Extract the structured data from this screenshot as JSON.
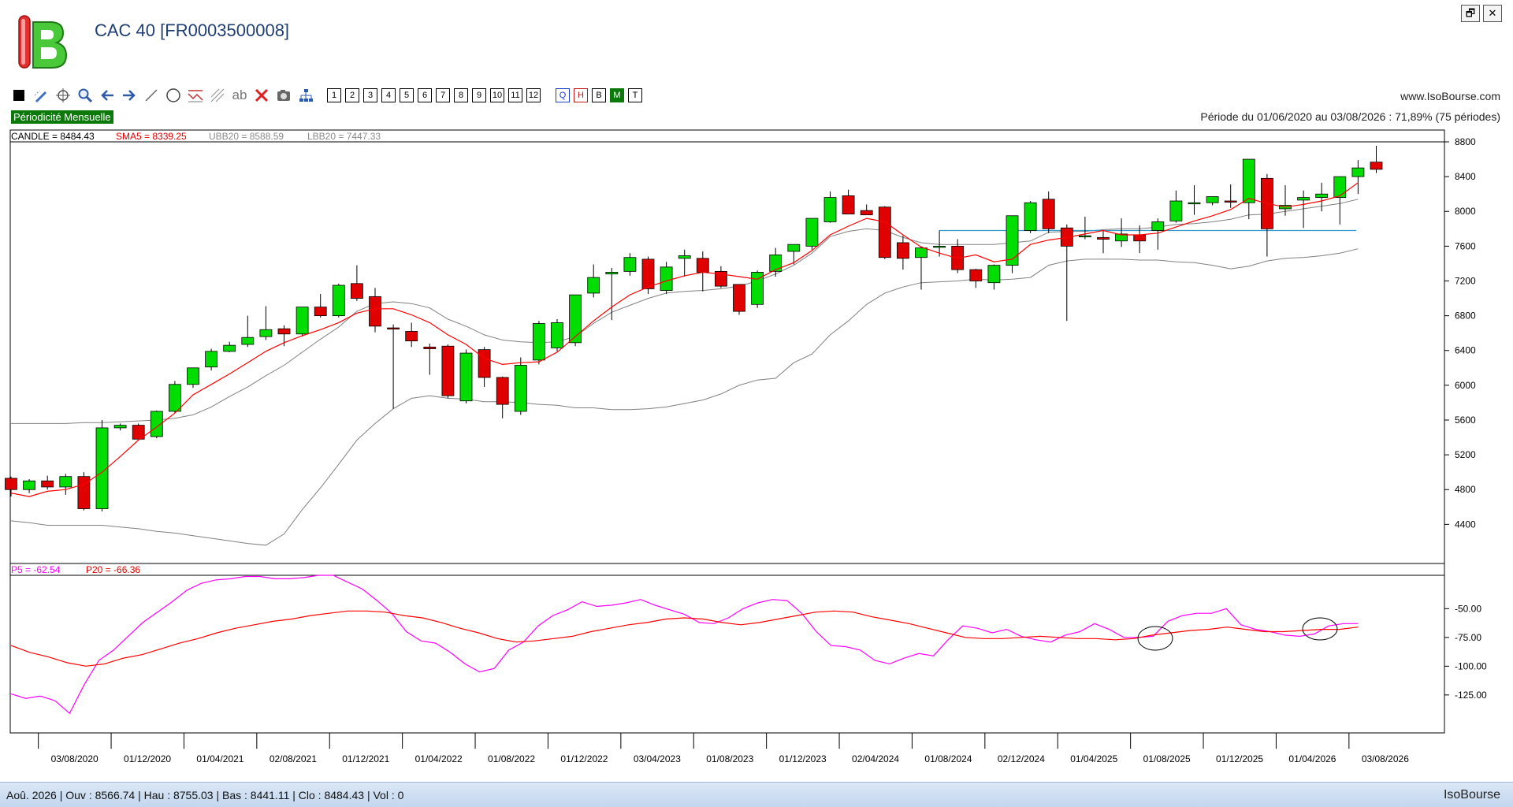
{
  "app": {
    "title": "CAC 40 [FR0003500008]",
    "website": "www.IsoBourse.com",
    "periodicity": "Périodicité Mensuelle",
    "period": "Période du 01/06/2020 au 03/08/2026 : 71,89% (75 périodes)",
    "brand": "IsoBourse",
    "status": "Aoû. 2026 | Ouv : 8566.74 | Hau : 8755.03 | Bas : 8441.11 | Clo : 8484.43 | Vol : 0",
    "window_buttons": {
      "restore": "🗗",
      "close": "✕"
    }
  },
  "toolbar": {
    "icons": [
      "square-icon",
      "pen-icon",
      "crosshair-icon",
      "zoom-icon",
      "arrow-left-icon",
      "arrow-right-icon",
      "line-icon",
      "circle-icon",
      "indicator-icon",
      "fibonacci-icon",
      "text-icon",
      "delete-icon",
      "camera-icon",
      "tree-icon"
    ],
    "text_tool_label": "ab",
    "numbers": [
      "1",
      "2",
      "3",
      "4",
      "5",
      "6",
      "7",
      "8",
      "9",
      "10",
      "11",
      "12"
    ],
    "letters": [
      "Q",
      "H",
      "B",
      "M",
      "T"
    ]
  },
  "legend": {
    "candle": "CANDLE = 8484.43",
    "sma": "SMA5 = 8339.25",
    "ubb": "UBB20 = 8588.59",
    "lbb": "LBB20 = 7447.33",
    "p5": "P5 = -62.54",
    "p20": "P20 = -66.36"
  },
  "colors": {
    "up": "#00dd00",
    "down": "#e00000",
    "sma": "#ff0000",
    "bands": "#808080",
    "p5": "#ff00ff",
    "p20": "#ff0000",
    "hline": "#3399cc"
  },
  "chart_data": [
    {
      "type": "candlestick",
      "yticks": [
        8800,
        8400,
        8000,
        7600,
        7200,
        6800,
        6400,
        6000,
        5600,
        5200,
        4800,
        4400
      ],
      "ylim": [
        3950,
        8800
      ],
      "xtick_labels": [
        "03/08/2020",
        "01/12/2020",
        "01/04/2021",
        "02/08/2021",
        "01/12/2021",
        "01/04/2022",
        "01/08/2022",
        "01/12/2022",
        "03/04/2023",
        "01/08/2023",
        "01/12/2023",
        "02/04/2024",
        "01/08/2024",
        "02/12/2024",
        "01/04/2025",
        "01/08/2025",
        "01/12/2025",
        "01/04/2026",
        "03/08/2026"
      ],
      "xtick_index": [
        2,
        6,
        10,
        14,
        18,
        22,
        26,
        30,
        34,
        38,
        42,
        46,
        50,
        54,
        58,
        62,
        66,
        70,
        74
      ],
      "horizontal_line": 7780,
      "candles": [
        [
          4930,
          4950,
          4720,
          4800
        ],
        [
          4800,
          4920,
          4760,
          4900
        ],
        [
          4900,
          4960,
          4800,
          4830
        ],
        [
          4830,
          4980,
          4740,
          4950
        ],
        [
          4950,
          5000,
          4560,
          4580
        ],
        [
          4580,
          5600,
          4550,
          5510
        ],
        [
          5510,
          5560,
          5480,
          5540
        ],
        [
          5540,
          5560,
          5380,
          5380
        ],
        [
          5410,
          5710,
          5390,
          5700
        ],
        [
          5700,
          6050,
          5680,
          6010
        ],
        [
          6010,
          6120,
          5970,
          6200
        ],
        [
          6210,
          6420,
          6170,
          6390
        ],
        [
          6390,
          6500,
          6380,
          6460
        ],
        [
          6470,
          6800,
          6440,
          6550
        ],
        [
          6560,
          6910,
          6520,
          6640
        ],
        [
          6650,
          6690,
          6450,
          6590
        ],
        [
          6590,
          6890,
          6560,
          6900
        ],
        [
          6900,
          7050,
          6780,
          6800
        ],
        [
          6800,
          7170,
          6780,
          7150
        ],
        [
          7170,
          7380,
          6970,
          7000
        ],
        [
          7020,
          7120,
          6610,
          6680
        ],
        [
          6660,
          6700,
          5730,
          6650
        ],
        [
          6620,
          6720,
          6440,
          6510
        ],
        [
          6440,
          6480,
          6120,
          6420
        ],
        [
          6450,
          6470,
          5850,
          5880
        ],
        [
          5820,
          6410,
          5790,
          6370
        ],
        [
          6410,
          6440,
          5980,
          6090
        ],
        [
          6090,
          6100,
          5620,
          5780
        ],
        [
          5700,
          6320,
          5660,
          6230
        ],
        [
          6290,
          6740,
          6240,
          6710
        ],
        [
          6430,
          6760,
          6390,
          6720
        ],
        [
          6490,
          7040,
          6450,
          7040
        ],
        [
          7060,
          7390,
          7010,
          7240
        ],
        [
          7280,
          7350,
          6750,
          7300
        ],
        [
          7310,
          7520,
          7260,
          7470
        ],
        [
          7450,
          7480,
          7050,
          7110
        ],
        [
          7090,
          7420,
          7050,
          7360
        ],
        [
          7460,
          7560,
          7250,
          7490
        ],
        [
          7460,
          7540,
          7080,
          7300
        ],
        [
          7310,
          7370,
          7120,
          7140
        ],
        [
          7160,
          7160,
          6810,
          6850
        ],
        [
          6930,
          7320,
          6890,
          7300
        ],
        [
          7310,
          7580,
          7250,
          7500
        ],
        [
          7540,
          7620,
          7390,
          7620
        ],
        [
          7600,
          7700,
          7560,
          7920
        ],
        [
          7880,
          8230,
          7870,
          8160
        ],
        [
          8180,
          8250,
          8000,
          7970
        ],
        [
          8010,
          8080,
          7960,
          7960
        ],
        [
          8050,
          8060,
          7450,
          7470
        ],
        [
          7640,
          7720,
          7330,
          7460
        ],
        [
          7470,
          7600,
          7100,
          7580
        ],
        [
          7600,
          7780,
          7480,
          7600
        ],
        [
          7600,
          7680,
          7290,
          7330
        ],
        [
          7330,
          7340,
          7120,
          7200
        ],
        [
          7180,
          7390,
          7100,
          7380
        ],
        [
          7380,
          7920,
          7290,
          7950
        ],
        [
          7780,
          8120,
          7750,
          8100
        ],
        [
          8140,
          8230,
          7750,
          7800
        ],
        [
          7810,
          7850,
          6740,
          7600
        ],
        [
          7720,
          7940,
          7680,
          7720
        ],
        [
          7700,
          7780,
          7520,
          7680
        ],
        [
          7660,
          7920,
          7590,
          7740
        ],
        [
          7730,
          7840,
          7520,
          7660
        ],
        [
          7780,
          7920,
          7560,
          7880
        ],
        [
          7890,
          8240,
          7870,
          8120
        ],
        [
          8100,
          8300,
          7960,
          8100
        ],
        [
          8100,
          8140,
          8070,
          8170
        ],
        [
          8120,
          8310,
          8040,
          8110
        ],
        [
          8100,
          8360,
          7910,
          8600
        ],
        [
          8380,
          8430,
          7480,
          7800
        ],
        [
          8030,
          8300,
          7950,
          8070
        ],
        [
          8130,
          8240,
          7810,
          8160
        ],
        [
          8160,
          8330,
          8000,
          8200
        ],
        [
          8160,
          8400,
          7850,
          8400
        ],
        [
          8400,
          8590,
          8200,
          8500
        ],
        [
          8567,
          8755,
          8441,
          8484
        ]
      ],
      "sma5": [
        4760,
        4720,
        4780,
        4800,
        4860,
        5000,
        5180,
        5370,
        5520,
        5680,
        5890,
        6010,
        6130,
        6260,
        6390,
        6490,
        6570,
        6640,
        6720,
        6830,
        6880,
        6880,
        6810,
        6720,
        6580,
        6470,
        6310,
        6240,
        6260,
        6270,
        6380,
        6560,
        6740,
        6900,
        7040,
        7130,
        7200,
        7260,
        7300,
        7280,
        7250,
        7220,
        7330,
        7410,
        7550,
        7730,
        7830,
        7920,
        7880,
        7730,
        7590,
        7520,
        7460,
        7500,
        7420,
        7450,
        7620,
        7670,
        7700,
        7740,
        7780,
        7730,
        7730,
        7750,
        7820,
        7890,
        7950,
        8020,
        8150,
        8090,
        8050,
        8080,
        8120,
        8180,
        8330
      ],
      "ubb20": [
        5560,
        5560,
        5560,
        5560,
        5570,
        5570,
        5580,
        5590,
        5600,
        5620,
        5660,
        5750,
        5870,
        5980,
        6110,
        6230,
        6380,
        6530,
        6670,
        6850,
        6940,
        6960,
        6940,
        6890,
        6760,
        6680,
        6580,
        6520,
        6500,
        6490,
        6500,
        6560,
        6710,
        6840,
        6920,
        7000,
        7060,
        7080,
        7090,
        7110,
        7140,
        7200,
        7280,
        7380,
        7520,
        7710,
        7770,
        7800,
        7780,
        7700,
        7640,
        7620,
        7620,
        7620,
        7620,
        7640,
        7660,
        7760,
        7770,
        7770,
        7790,
        7800,
        7800,
        7820,
        7850,
        7860,
        7880,
        7910,
        7960,
        7970,
        8000,
        8030,
        8060,
        8090,
        8140
      ],
      "lbb20": [
        4440,
        4420,
        4390,
        4390,
        4390,
        4390,
        4370,
        4350,
        4320,
        4300,
        4270,
        4240,
        4210,
        4180,
        4160,
        4290,
        4570,
        4820,
        5090,
        5370,
        5560,
        5730,
        5850,
        5880,
        5850,
        5840,
        5810,
        5810,
        5800,
        5780,
        5770,
        5740,
        5740,
        5720,
        5720,
        5730,
        5750,
        5790,
        5830,
        5900,
        6000,
        6060,
        6080,
        6260,
        6360,
        6580,
        6740,
        6930,
        7060,
        7130,
        7180,
        7190,
        7200,
        7220,
        7210,
        7220,
        7240,
        7380,
        7430,
        7450,
        7450,
        7450,
        7440,
        7440,
        7420,
        7410,
        7380,
        7340,
        7370,
        7430,
        7460,
        7470,
        7490,
        7520,
        7570
      ]
    },
    {
      "type": "line",
      "yticks": [
        -50,
        -75,
        -100,
        -125
      ],
      "ylim": [
        -158,
        -21
      ],
      "series": [
        {
          "name": "P5",
          "values": [
            -124,
            -128,
            -126,
            -130,
            -141,
            -116,
            -95,
            -86,
            -74,
            -62,
            -53,
            -44,
            -34,
            -28,
            -25,
            -24,
            -22,
            -22,
            -24,
            -24,
            -23,
            -21,
            -21,
            -27,
            -33,
            -43,
            -54,
            -70,
            -78,
            -80,
            -88,
            -98,
            -105,
            -102,
            -86,
            -79,
            -65,
            -56,
            -51,
            -44,
            -48,
            -47,
            -45,
            -42,
            -47,
            -51,
            -55,
            -62,
            -63,
            -58,
            -50,
            -45,
            -42,
            -43,
            -54,
            -70,
            -82,
            -83,
            -86,
            -95,
            -98,
            -93,
            -89,
            -91,
            -77,
            -65,
            -67,
            -71,
            -68,
            -74,
            -77,
            -79,
            -73,
            -70,
            -63,
            -68,
            -75,
            -75,
            -74,
            -61,
            -56,
            -54,
            -54,
            -50,
            -64,
            -68,
            -70,
            -73,
            -74,
            -72,
            -65,
            -63,
            -63
          ]
        },
        {
          "name": "P20",
          "values": [
            -82,
            -88,
            -92,
            -97,
            -100,
            -98,
            -93,
            -90,
            -85,
            -80,
            -76,
            -71,
            -67,
            -64,
            -61,
            -59,
            -56,
            -54,
            -52,
            -52,
            -53,
            -56,
            -58,
            -62,
            -67,
            -71,
            -76,
            -79,
            -78,
            -76,
            -74,
            -70,
            -67,
            -64,
            -62,
            -59,
            -58,
            -59,
            -62,
            -64,
            -62,
            -59,
            -56,
            -53,
            -52,
            -53,
            -57,
            -60,
            -63,
            -67,
            -71,
            -75,
            -76,
            -76,
            -75,
            -74,
            -75,
            -76,
            -76,
            -77,
            -76,
            -73,
            -71,
            -69,
            -68,
            -66,
            -68,
            -70,
            -70,
            -69,
            -68,
            -68,
            -66
          ]
        }
      ]
    }
  ]
}
